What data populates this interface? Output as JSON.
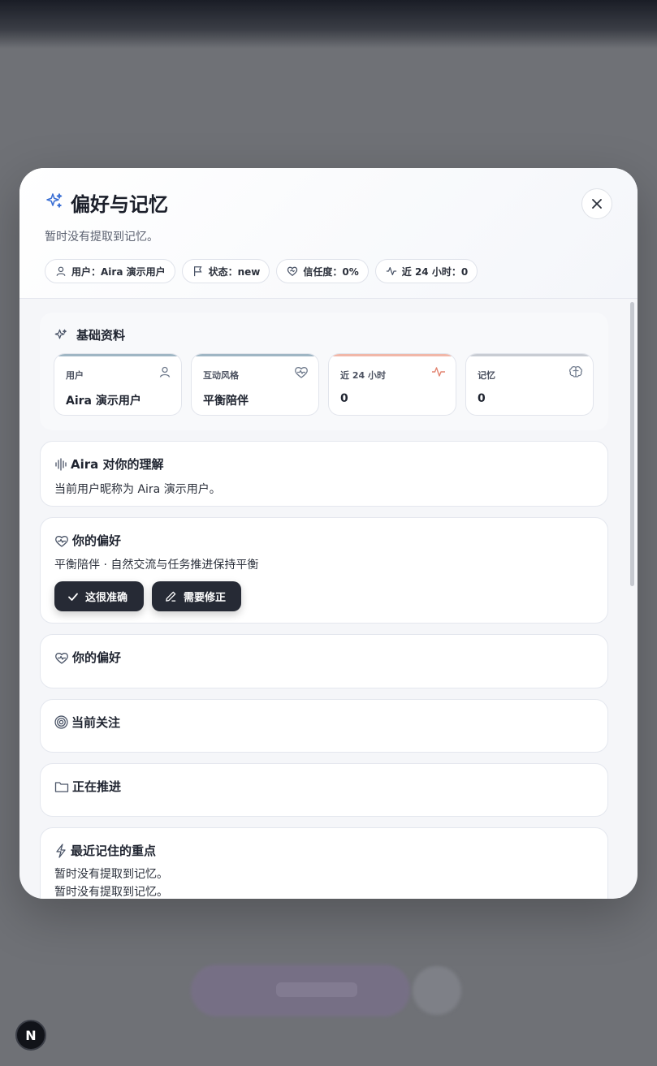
{
  "modal": {
    "title": "偏好与记忆",
    "subtitle": "暂时没有提取到记忆。",
    "chips": [
      {
        "label": "用户：Aira 演示用户"
      },
      {
        "label": "状态：new"
      },
      {
        "label": "信任度：0%"
      },
      {
        "label": "近 24 小时：0"
      }
    ]
  },
  "basic": {
    "title": "基础资料",
    "stats": [
      {
        "label": "用户",
        "value": "Aira 演示用户",
        "icon": "user-icon",
        "accent": "#9fb6c4"
      },
      {
        "label": "互动风格",
        "value": "平衡陪伴",
        "icon": "heart-pulse-icon",
        "accent": "#9fb6c4"
      },
      {
        "label": "近 24 小时",
        "value": "0",
        "icon": "activity-icon",
        "accent": "#f1b7a8"
      },
      {
        "label": "记忆",
        "value": "0",
        "icon": "brain-icon",
        "accent": "#c8ccd3"
      }
    ]
  },
  "understanding": {
    "title": "Aira 对你的理解",
    "text": "当前用户昵称为 Aira 演示用户。"
  },
  "preference": {
    "title": "你的偏好",
    "text": "平衡陪伴 · 自然交流与任务推进保持平衡",
    "confirm_label": "这很准确",
    "fix_label": "需要修正"
  },
  "preference2": {
    "title": "你的偏好"
  },
  "focus": {
    "title": "当前关注"
  },
  "progress": {
    "title": "正在推进"
  },
  "recent": {
    "title": "最近记住的重点",
    "lines": [
      "暂时没有提取到记忆。",
      "暂时没有提取到记忆。"
    ]
  },
  "badge": {
    "letter": "N"
  }
}
